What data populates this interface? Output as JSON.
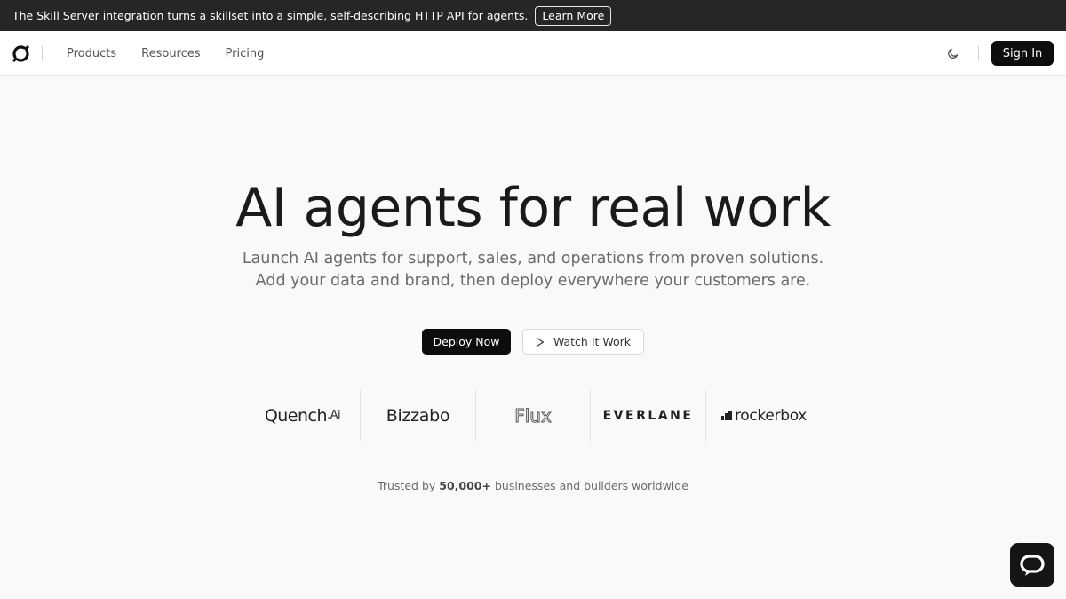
{
  "announcement": {
    "text": "The Skill Server integration turns a skillset into a simple, self-describing HTTP API for agents.",
    "button_label": "Learn More"
  },
  "nav": {
    "logo_icon": "brand-logo-icon",
    "links": [
      "Products",
      "Resources",
      "Pricing"
    ],
    "theme_icon": "moon-icon",
    "signin_label": "Sign In"
  },
  "hero": {
    "title": "AI agents for real work",
    "subtitle_line1": "Launch AI agents for support, sales, and operations from proven solutions.",
    "subtitle_line2": "Add your data and brand, then deploy everywhere your customers are.",
    "primary_cta": "Deploy Now",
    "secondary_cta": "Watch It Work"
  },
  "logos": {
    "quench": "Quench",
    "quench_suffix": ".Ai",
    "bizzabo": "Bizzabo",
    "flux": "Flux",
    "everlane": "EVERLANE",
    "rockerbox": "rockerbox"
  },
  "trusted": {
    "prefix": "Trusted by ",
    "count": "50,000+",
    "suffix": " businesses and builders worldwide"
  },
  "chat": {
    "icon": "chat-bubble-icon"
  },
  "colors": {
    "announcement_bg": "#262626",
    "page_bg": "#f9f9f9",
    "primary_button": "#0d0d0d"
  }
}
